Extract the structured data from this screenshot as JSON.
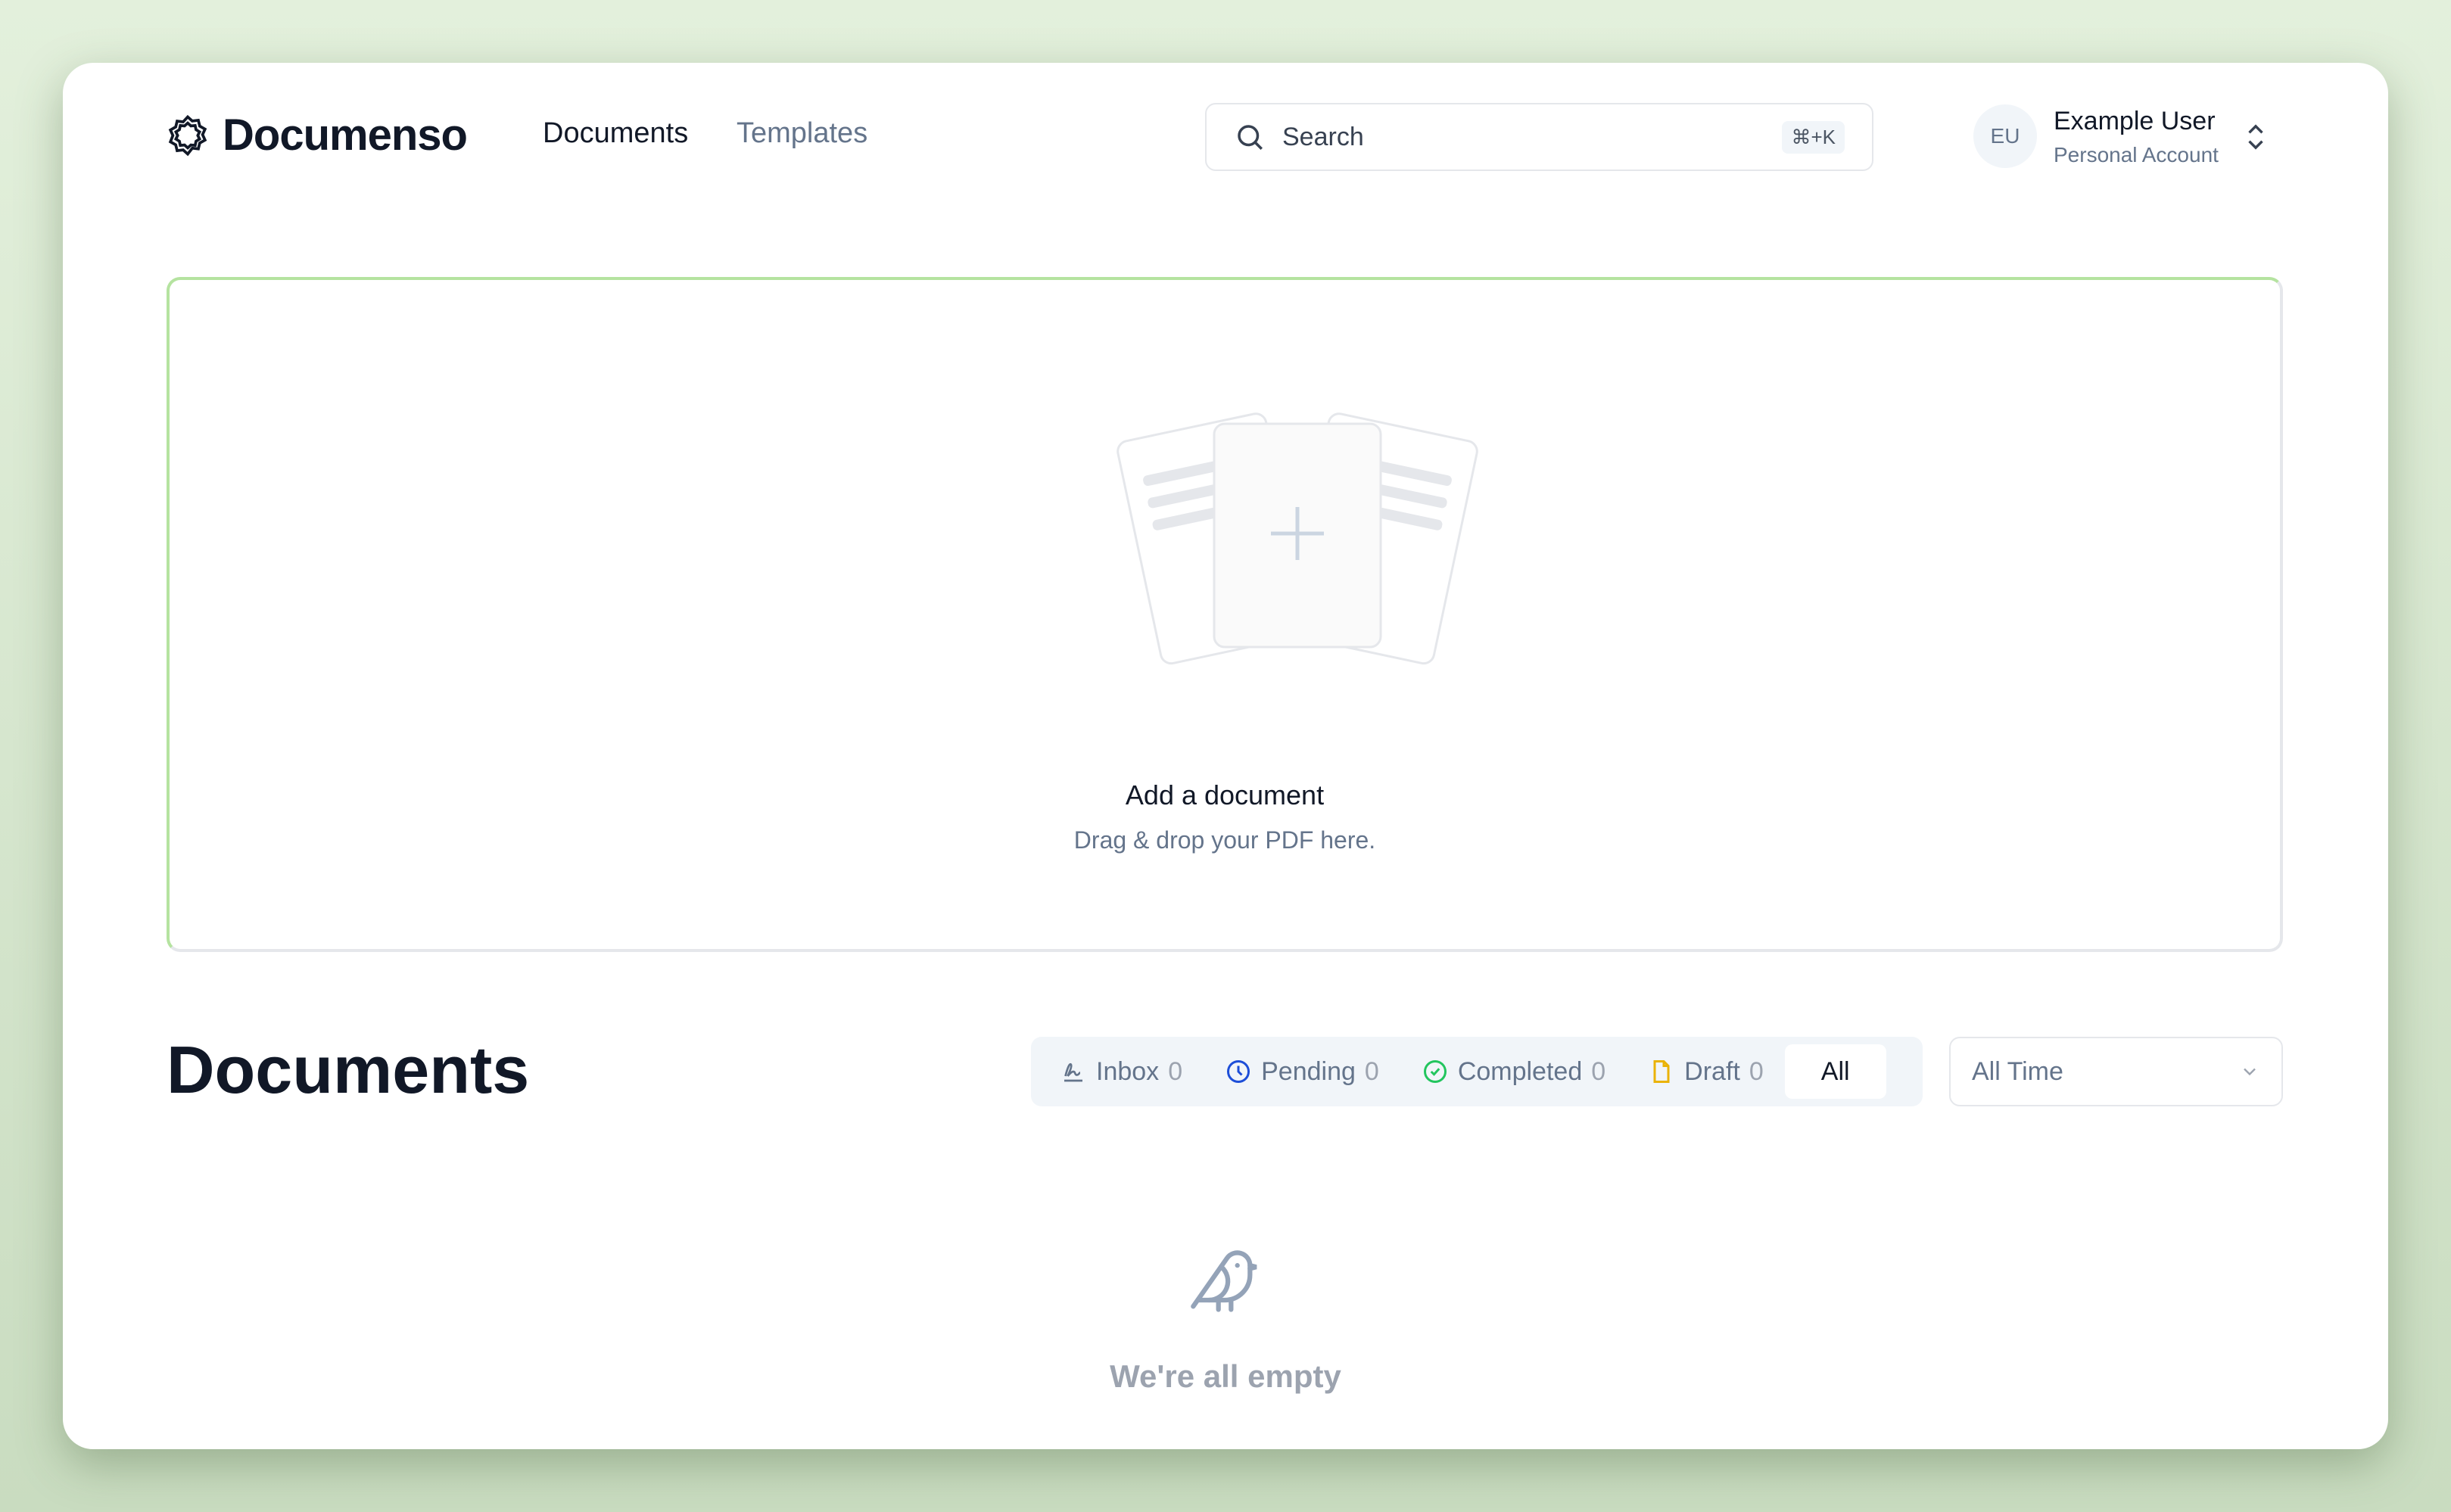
{
  "brand": {
    "name": "Documenso"
  },
  "nav": {
    "items": [
      {
        "label": "Documents",
        "active": true
      },
      {
        "label": "Templates",
        "active": false
      }
    ]
  },
  "search": {
    "placeholder": "Search",
    "shortcut": "⌘+K"
  },
  "user": {
    "initials": "EU",
    "name": "Example User",
    "account": "Personal Account"
  },
  "dropzone": {
    "title": "Add a document",
    "subtitle": "Drag & drop your PDF here."
  },
  "documents": {
    "title": "Documents",
    "tabs": [
      {
        "label": "Inbox",
        "count": "0",
        "icon": "signature-icon",
        "color": "#64748b"
      },
      {
        "label": "Pending",
        "count": "0",
        "icon": "clock-icon",
        "color": "#1d4ed8"
      },
      {
        "label": "Completed",
        "count": "0",
        "icon": "check-circle-icon",
        "color": "#22c55e"
      },
      {
        "label": "Draft",
        "count": "0",
        "icon": "file-icon",
        "color": "#eab308"
      },
      {
        "label": "All",
        "active": true
      }
    ],
    "period": {
      "selected": "All Time"
    },
    "empty": {
      "title": "We're all empty",
      "icon": "bird-icon"
    }
  }
}
